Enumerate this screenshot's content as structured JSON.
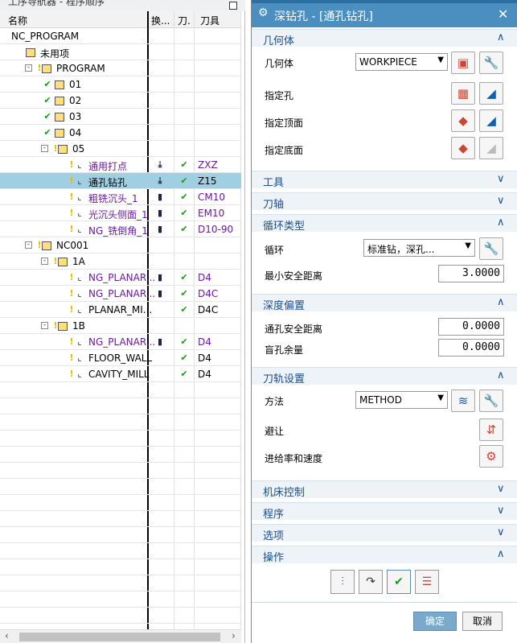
{
  "navigator": {
    "title": "工序导航器 - 程序顺序",
    "columns": [
      "名称",
      "换...",
      "刀.",
      "刀具"
    ],
    "rows": [
      {
        "name": "NC_PROGRAM",
        "indent": 0,
        "icons": [],
        "change": "",
        "path": "",
        "tool": ""
      },
      {
        "name": "未用项",
        "indent": 1,
        "icons": [
          "folder"
        ],
        "change": "",
        "path": "",
        "tool": ""
      },
      {
        "name": "PROGRAM",
        "indent": 1,
        "toggle": "-",
        "icons": [
          "bulb",
          "folder"
        ],
        "change": "",
        "path": "",
        "tool": ""
      },
      {
        "name": "01",
        "indent": 2,
        "icons": [
          "check",
          "folder"
        ],
        "change": "",
        "path": "",
        "tool": ""
      },
      {
        "name": "02",
        "indent": 2,
        "icons": [
          "check",
          "folder"
        ],
        "change": "",
        "path": "",
        "tool": ""
      },
      {
        "name": "03",
        "indent": 2,
        "icons": [
          "check",
          "folder"
        ],
        "change": "",
        "path": "",
        "tool": ""
      },
      {
        "name": "04",
        "indent": 2,
        "icons": [
          "check",
          "folder"
        ],
        "change": "",
        "path": "",
        "tool": ""
      },
      {
        "name": "05",
        "indent": 2,
        "toggle": "-",
        "icons": [
          "bulb",
          "folder"
        ],
        "change": "",
        "path": "",
        "tool": ""
      },
      {
        "name": "通用打点",
        "indent": 3,
        "icons": [
          "bulb",
          "op"
        ],
        "change": "drill",
        "path": "check",
        "tool": "ZXZ",
        "purple": true
      },
      {
        "name": "通孔钻孔",
        "indent": 3,
        "icons": [
          "bulb",
          "op"
        ],
        "change": "drill",
        "path": "check",
        "tool": "Z15",
        "selected": true
      },
      {
        "name": "粗铣沉头_1",
        "indent": 3,
        "icons": [
          "bulb",
          "op"
        ],
        "change": "mill",
        "path": "check",
        "tool": "CM10",
        "purple": true
      },
      {
        "name": "光沉头侧面_1",
        "indent": 3,
        "icons": [
          "bulb",
          "op"
        ],
        "change": "mill",
        "path": "check",
        "tool": "EM10",
        "purple": true
      },
      {
        "name": "NG_铣倒角_1",
        "indent": 3,
        "icons": [
          "bulb",
          "op"
        ],
        "change": "mill",
        "path": "check",
        "tool": "D10-90",
        "purple": true
      },
      {
        "name": "NC001",
        "indent": 1,
        "toggle": "-",
        "icons": [
          "bulb",
          "folder"
        ],
        "change": "",
        "path": "",
        "tool": ""
      },
      {
        "name": "1A",
        "indent": 2,
        "toggle": "-",
        "icons": [
          "bulb",
          "folder"
        ],
        "change": "",
        "path": "",
        "tool": ""
      },
      {
        "name": "NG_PLANAR...",
        "indent": 3,
        "icons": [
          "bulb",
          "op"
        ],
        "change": "mill",
        "path": "check",
        "tool": "D4",
        "purple": true
      },
      {
        "name": "NG_PLANAR...",
        "indent": 3,
        "icons": [
          "bulb",
          "op"
        ],
        "change": "mill",
        "path": "check",
        "tool": "D4C",
        "purple": true
      },
      {
        "name": "PLANAR_MI...",
        "indent": 3,
        "icons": [
          "bulb",
          "op"
        ],
        "change": "",
        "path": "check",
        "tool": "D4C"
      },
      {
        "name": "1B",
        "indent": 2,
        "toggle": "-",
        "icons": [
          "bulb",
          "folder"
        ],
        "change": "",
        "path": "",
        "tool": ""
      },
      {
        "name": "NG_PLANAR...",
        "indent": 3,
        "icons": [
          "bulb",
          "op"
        ],
        "change": "mill",
        "path": "check",
        "tool": "D4",
        "purple": true
      },
      {
        "name": "FLOOR_WALL",
        "indent": 3,
        "icons": [
          "bulb",
          "op"
        ],
        "change": "",
        "path": "check",
        "tool": "D4"
      },
      {
        "name": "CAVITY_MILL",
        "indent": 3,
        "icons": [
          "bulb",
          "op"
        ],
        "change": "",
        "path": "check",
        "tool": "D4"
      }
    ]
  },
  "dialog": {
    "title": "深钻孔 - [通孔钻孔]",
    "sections": {
      "geometry": "几何体",
      "tool": "工具",
      "tool_axis": "刀轴",
      "cycle_type": "循环类型",
      "depth_offset": "深度偏置",
      "path_settings": "刀轨设置",
      "machine_control": "机床控制",
      "program": "程序",
      "options": "选项",
      "actions": "操作"
    },
    "geometry": {
      "label": "几何体",
      "value": "WORKPIECE",
      "specify_holes": "指定孔",
      "specify_top": "指定顶面",
      "specify_bottom": "指定底面"
    },
    "cycle": {
      "label": "循环",
      "value": "标准钻，深孔...",
      "min_clearance_label": "最小安全距离",
      "min_clearance": "3.0000"
    },
    "depth": {
      "through_label": "通孔安全距离",
      "through": "0.0000",
      "blind_label": "盲孔余量",
      "blind": "0.0000"
    },
    "path": {
      "method_label": "方法",
      "method": "METHOD",
      "avoid_label": "避让",
      "feeds_label": "进给率和速度"
    },
    "ok_label": "确定",
    "cancel_label": "取消"
  }
}
